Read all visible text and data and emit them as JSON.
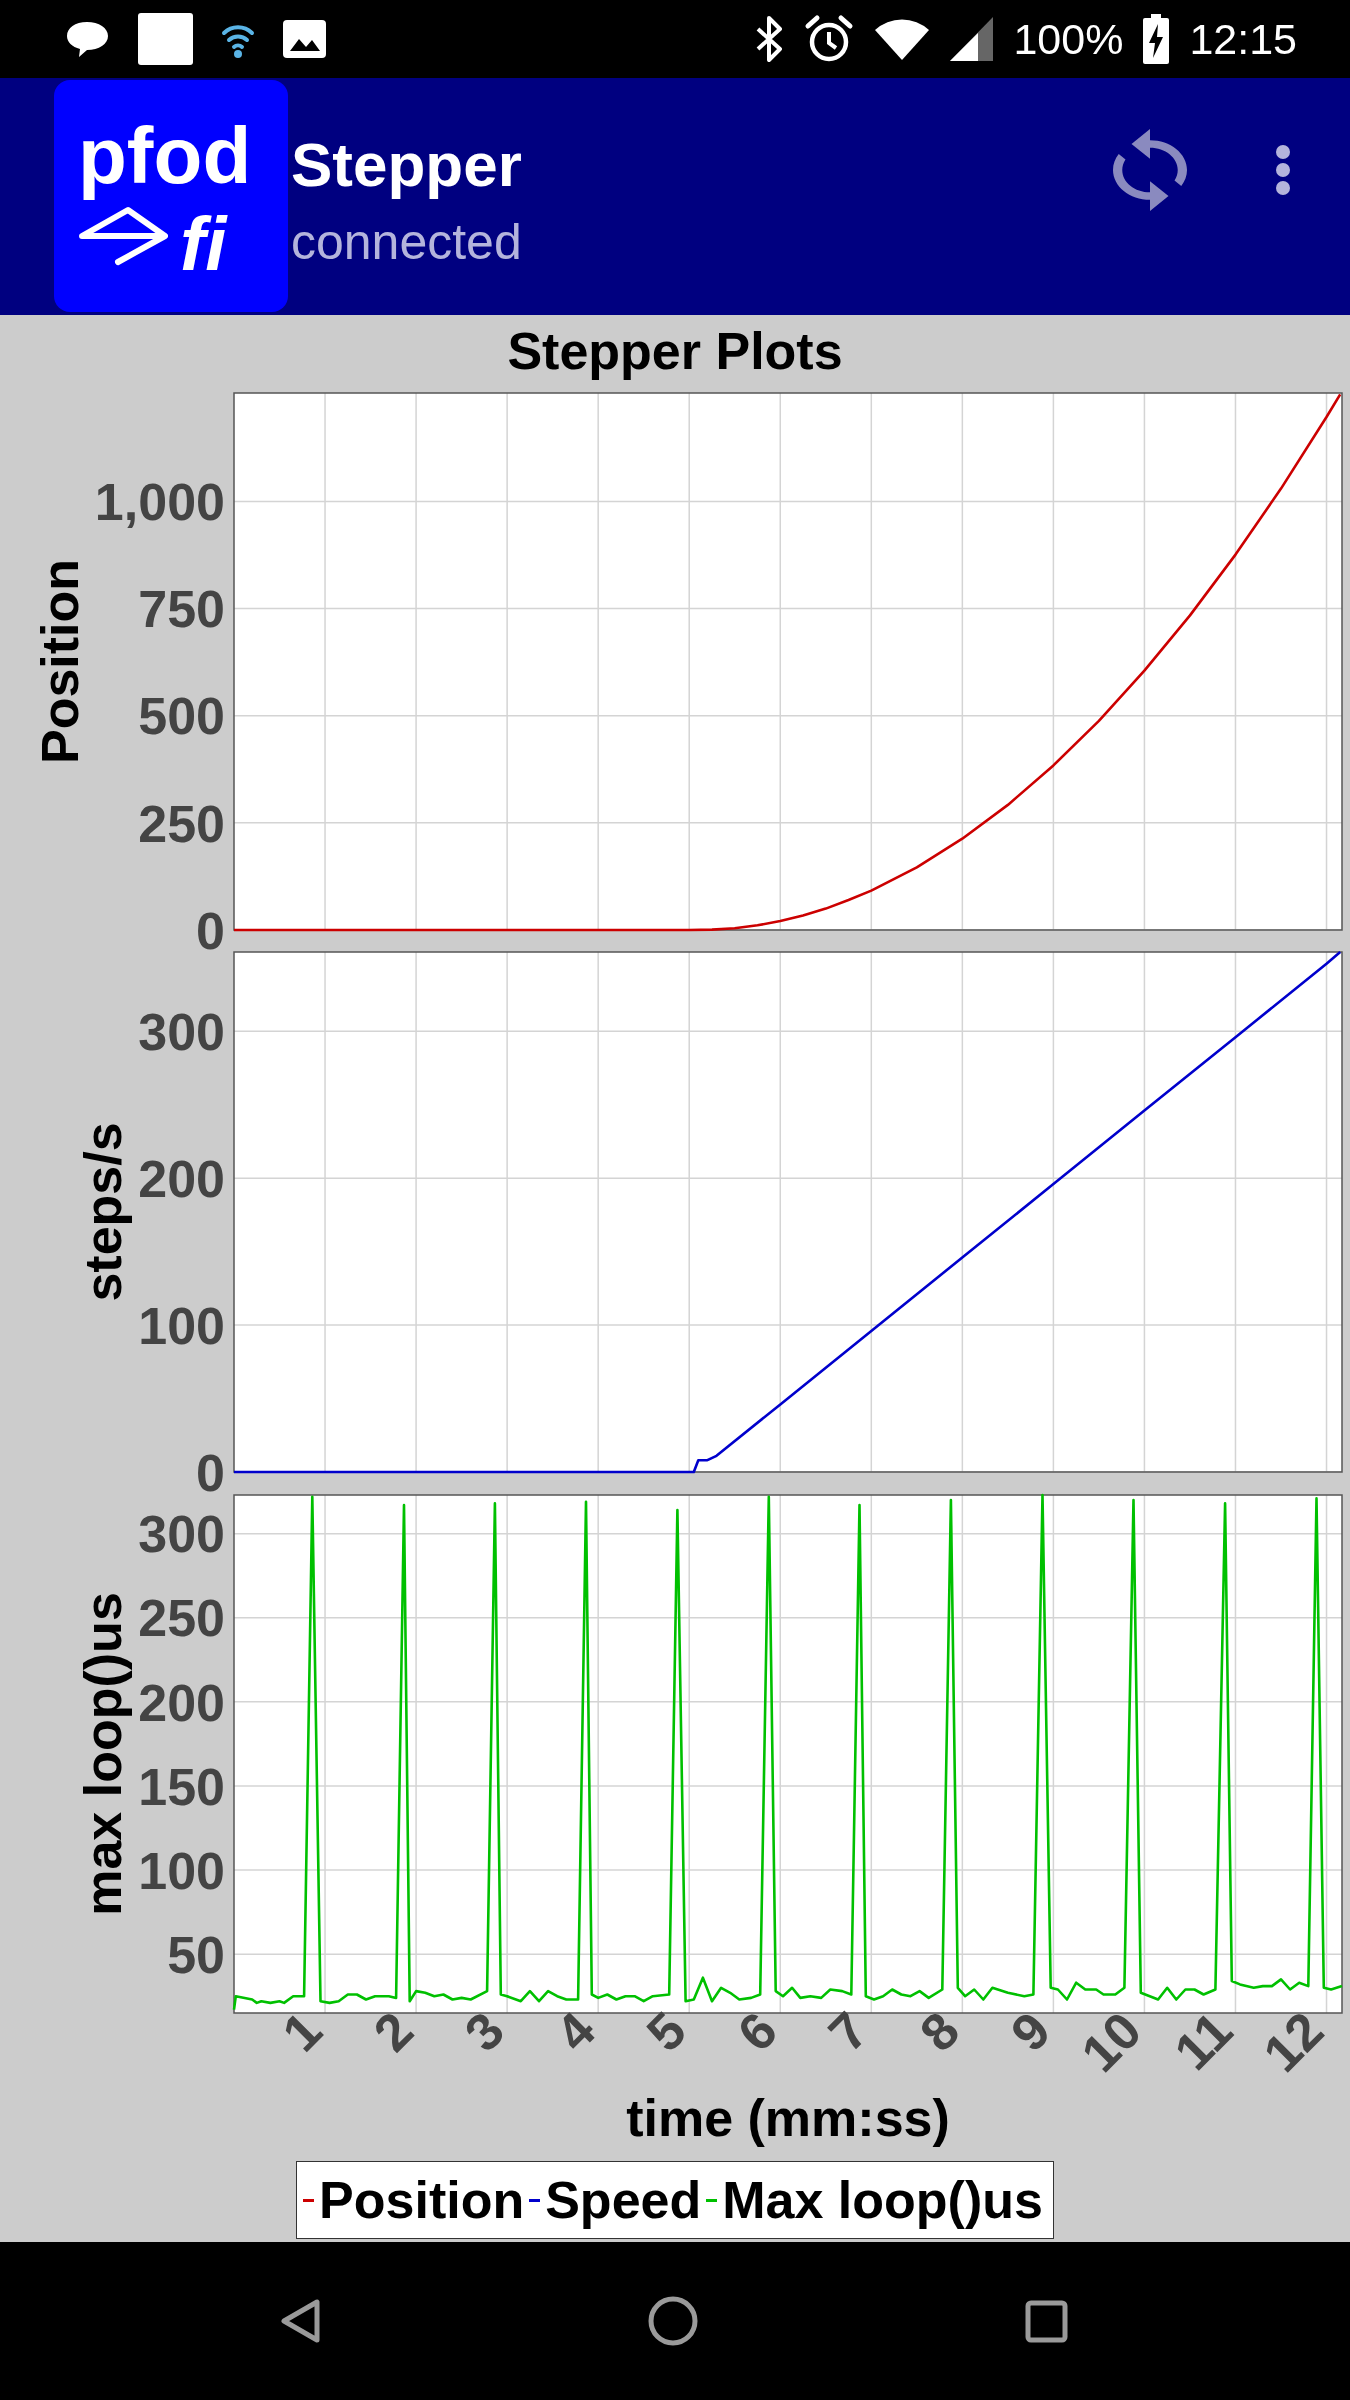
{
  "status_bar": {
    "battery": "100%",
    "time": "12:15"
  },
  "app_bar": {
    "logo": {
      "top": "pfod",
      "bottom": "fi"
    },
    "title": "Stepper",
    "subtitle": "connected"
  },
  "plot_panel": {
    "title": "Stepper Plots",
    "charts": [
      {
        "chart_data": {
          "type": "line",
          "ylabel": "Position",
          "grid": true,
          "x": [
            0,
            1,
            2,
            3,
            4,
            5,
            5.25,
            5.5,
            5.75,
            6,
            6.25,
            6.5,
            6.75,
            7,
            7.5,
            8,
            8.5,
            9,
            9.5,
            10,
            10.5,
            11,
            11.5,
            12,
            12.15
          ],
          "series": [
            {
              "name": "Position",
              "color": "#cc0000",
              "values": [
                0,
                0,
                0,
                0,
                0,
                0,
                1,
                4,
                11,
                21,
                34,
                50,
                70,
                92,
                146,
                213,
                292,
                384,
                488,
                605,
                734,
                876,
                1030,
                1197,
                1250
              ]
            }
          ],
          "xlim": [
            0,
            12.17
          ],
          "ylim": [
            0,
            1253
          ],
          "yticks": [
            0,
            250,
            500,
            750,
            {
              "value": 1000,
              "label": "1,000"
            }
          ]
        }
      },
      {
        "chart_data": {
          "type": "line",
          "ylabel": "steps/s",
          "grid": true,
          "x": [
            0,
            1,
            2,
            3,
            4,
            5,
            5.05,
            5.1,
            5.2,
            5.3,
            6,
            7,
            8,
            9,
            10,
            11,
            12,
            12.15
          ],
          "series": [
            {
              "name": "Speed",
              "color": "#0000cc",
              "values": [
                0,
                0,
                0,
                0,
                0,
                0,
                0,
                8,
                8,
                11,
                46,
                96,
                146,
                196,
                246,
                296,
                346,
                354
              ]
            }
          ],
          "xlim": [
            0,
            12.17
          ],
          "ylim": [
            0,
            354
          ],
          "yticks": [
            0,
            100,
            200,
            300
          ]
        }
      },
      {
        "chart_data": {
          "type": "line",
          "xlabel": "time (mm:ss)",
          "ylabel": "max loop()us",
          "grid": true,
          "x": [
            0,
            0.02,
            0.2,
            0.25,
            0.3,
            0.4,
            0.5,
            0.55,
            0.65,
            0.77,
            0.86,
            0.95,
            1.05,
            1.15,
            1.25,
            1.35,
            1.45,
            1.55,
            1.7,
            1.78,
            1.867,
            1.93,
            2.0,
            2.1,
            2.2,
            2.3,
            2.4,
            2.5,
            2.6,
            2.78,
            2.866,
            2.93,
            3.0,
            3.15,
            3.25,
            3.35,
            3.45,
            3.55,
            3.65,
            3.78,
            3.866,
            3.93,
            4.0,
            4.1,
            4.2,
            4.3,
            4.4,
            4.5,
            4.6,
            4.78,
            4.87,
            4.96,
            5.05,
            5.15,
            5.25,
            5.35,
            5.45,
            5.55,
            5.68,
            5.78,
            5.874,
            5.95,
            6.03,
            6.13,
            6.22,
            6.33,
            6.45,
            6.55,
            6.68,
            6.78,
            6.87,
            6.94,
            7.03,
            7.13,
            7.23,
            7.33,
            7.43,
            7.53,
            7.63,
            7.78,
            7.874,
            7.95,
            8.03,
            8.13,
            8.23,
            8.33,
            8.5,
            8.68,
            8.78,
            8.88,
            8.97,
            9.05,
            9.15,
            9.25,
            9.35,
            9.47,
            9.55,
            9.68,
            9.78,
            9.88,
            9.96,
            10.15,
            10.25,
            10.35,
            10.45,
            10.55,
            10.65,
            10.78,
            10.886,
            10.96,
            11.05,
            11.2,
            11.3,
            11.4,
            11.5,
            11.6,
            11.7,
            11.8,
            11.89,
            11.97,
            12.05,
            12.17
          ],
          "series": [
            {
              "name": "Max loop()us",
              "color": "#00c000",
              "values": [
                17,
                25,
                23,
                21,
                22,
                21,
                22,
                21,
                25,
                25,
                322,
                22,
                21,
                22,
                26,
                26,
                23,
                25,
                25,
                24,
                317,
                22,
                28,
                27,
                25,
                26,
                23,
                24,
                23,
                28,
                318,
                26,
                25,
                22,
                28,
                22,
                28,
                25,
                23,
                23,
                319,
                26,
                24,
                26,
                23,
                25,
                25,
                22,
                25,
                26,
                314,
                22,
                23,
                36,
                22,
                30,
                27,
                23,
                24,
                26,
                322,
                28,
                25,
                30,
                24,
                25,
                24,
                29,
                28,
                26,
                317,
                25,
                23,
                25,
                29,
                26,
                25,
                28,
                24,
                29,
                320,
                30,
                25,
                29,
                23,
                30,
                27,
                25,
                26,
                323,
                30,
                29,
                23,
                33,
                29,
                29,
                26,
                26,
                30,
                320,
                27,
                23,
                30,
                23,
                29,
                29,
                26,
                29,
                318,
                34,
                32,
                30,
                31,
                31,
                35,
                29,
                33,
                31,
                321,
                30,
                29,
                31
              ]
            }
          ],
          "xlim": [
            0,
            12.17
          ],
          "ylim": [
            15,
            323
          ],
          "xticks": [
            1,
            2,
            3,
            4,
            5,
            6,
            7,
            8,
            9,
            10,
            11,
            12
          ],
          "yticks": [
            50,
            100,
            150,
            200,
            250,
            300
          ]
        }
      }
    ]
  }
}
